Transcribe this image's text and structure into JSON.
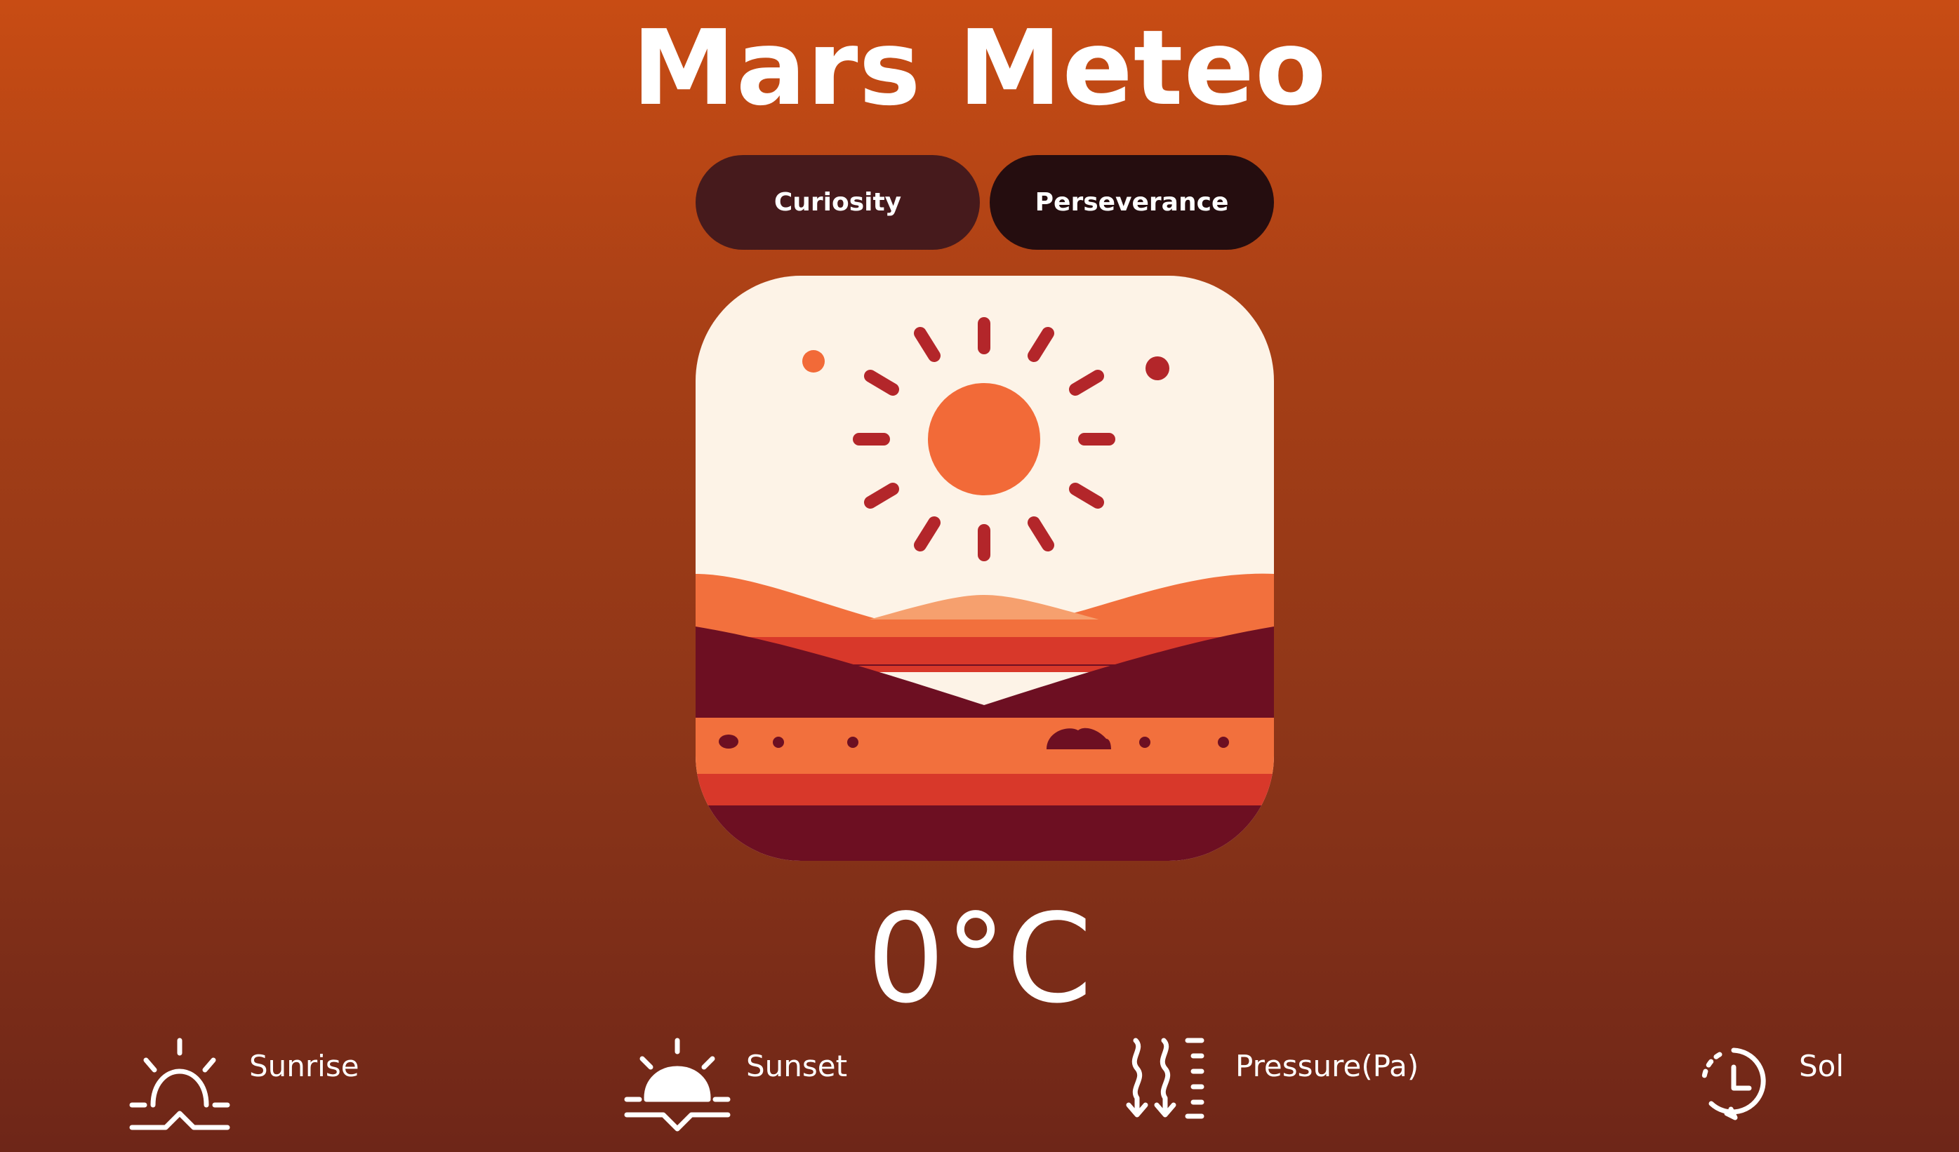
{
  "app": {
    "title": "Mars Meteo"
  },
  "rovers": {
    "curiosity_label": "Curiosity",
    "perseverance_label": "Perseverance"
  },
  "weather": {
    "icon": "sun-over-mars-dunes-icon",
    "temperature": "0°C"
  },
  "stats": {
    "sunrise": {
      "label": "Sunrise",
      "icon": "sunrise-icon"
    },
    "sunset": {
      "label": "Sunset",
      "icon": "sunset-icon"
    },
    "pressure": {
      "label": "Pressure(Pa)",
      "icon": "pressure-icon"
    },
    "sol": {
      "label": "Sol",
      "icon": "clock-icon"
    }
  },
  "colors": {
    "background_top": "#c84c14",
    "background_bottom": "#6e2618",
    "button_curiosity": "#461a1c",
    "button_perseverance": "#250d0f",
    "card_sky": "#fdf3e7",
    "sun": "#f26a38",
    "sun_rays": "#b3262a",
    "dune_light": "#f6a06e",
    "dune_orange": "#f2703d",
    "dune_red": "#d8382a",
    "dune_maroon": "#6d0f22"
  }
}
